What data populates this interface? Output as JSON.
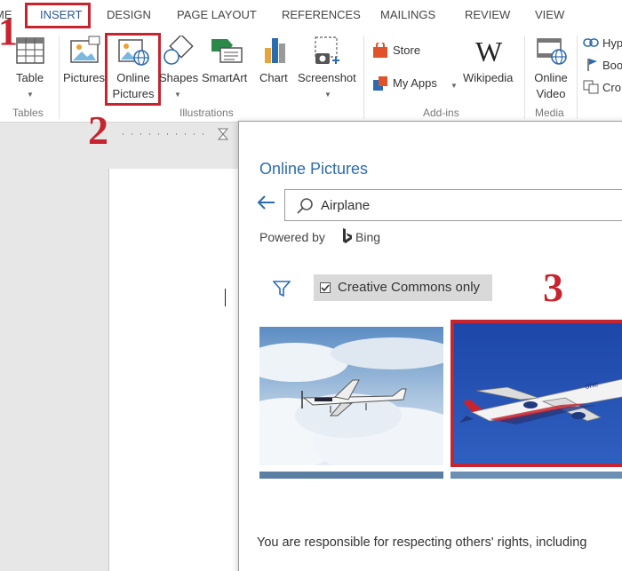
{
  "tabs": [
    {
      "label": "ME",
      "active": false
    },
    {
      "label": "INSERT",
      "active": true
    },
    {
      "label": "DESIGN",
      "active": false
    },
    {
      "label": "PAGE LAYOUT",
      "active": false
    },
    {
      "label": "REFERENCES",
      "active": false
    },
    {
      "label": "MAILINGS",
      "active": false
    },
    {
      "label": "REVIEW",
      "active": false
    },
    {
      "label": "VIEW",
      "active": false
    }
  ],
  "ribbon": {
    "table": "Table",
    "pictures": "Pictures",
    "online_pictures_line1": "Online",
    "online_pictures_line2": "Pictures",
    "shapes": "Shapes",
    "smartart": "SmartArt",
    "chart": "Chart",
    "screenshot": "Screenshot",
    "store": "Store",
    "my_apps": "My Apps",
    "wikipedia": "Wikipedia",
    "online_video_line1": "Online",
    "online_video_line2": "Video",
    "hyperlink": "Hyp",
    "bookmark": "Boo",
    "cross_reference": "Cro",
    "groups": {
      "tables": "Tables",
      "illustrations": "Illustrations",
      "addins": "Add-ins",
      "media": "Media"
    }
  },
  "steps": {
    "one": "1",
    "two": "2",
    "three": "3"
  },
  "dialog": {
    "title": "Online Pictures",
    "search_value": "Airplane",
    "powered_by": "Powered by",
    "bing": "Bing",
    "creative_commons": "Creative Commons only",
    "creative_commons_checked": true,
    "notice": "You are responsible for respecting others' rights, including"
  },
  "colors": {
    "accent": "#2b579a",
    "highlight": "#c8242f",
    "dialog_title": "#2b6cb0"
  }
}
